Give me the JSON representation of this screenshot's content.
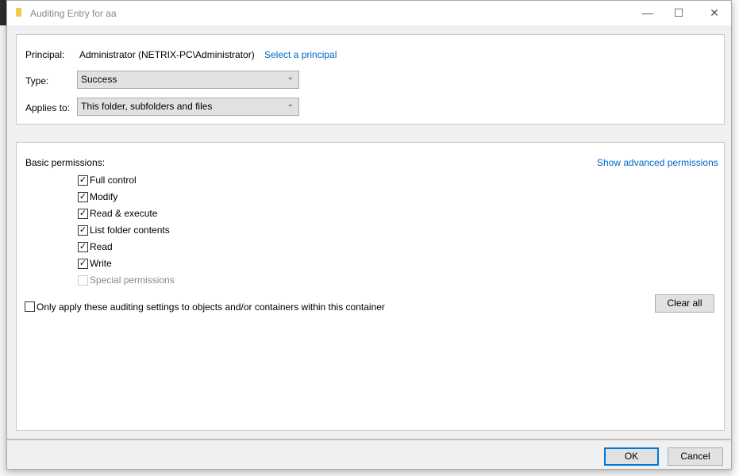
{
  "window": {
    "title": "Auditing Entry for aa",
    "minimize": "—",
    "maximize": "☐",
    "close": "✕"
  },
  "principal": {
    "label": "Principal:",
    "value": "Administrator (NETRIX-PC\\Administrator)",
    "link": "Select a principal"
  },
  "type": {
    "label": "Type:",
    "value": "Success"
  },
  "applies_to": {
    "label": "Applies to:",
    "value": "This folder, subfolders and files"
  },
  "permissions": {
    "heading": "Basic permissions:",
    "advanced_link": "Show advanced permissions",
    "items": [
      {
        "label": "Full control",
        "checked": true,
        "enabled": true
      },
      {
        "label": "Modify",
        "checked": true,
        "enabled": true
      },
      {
        "label": "Read & execute",
        "checked": true,
        "enabled": true
      },
      {
        "label": "List folder contents",
        "checked": true,
        "enabled": true
      },
      {
        "label": "Read",
        "checked": true,
        "enabled": true
      },
      {
        "label": "Write",
        "checked": true,
        "enabled": true
      },
      {
        "label": "Special permissions",
        "checked": false,
        "enabled": false
      }
    ],
    "only_apply": {
      "label": "Only apply these auditing settings to objects and/or containers within this container",
      "checked": false
    },
    "clear_all": "Clear all"
  },
  "buttons": {
    "ok": "OK",
    "cancel": "Cancel"
  }
}
